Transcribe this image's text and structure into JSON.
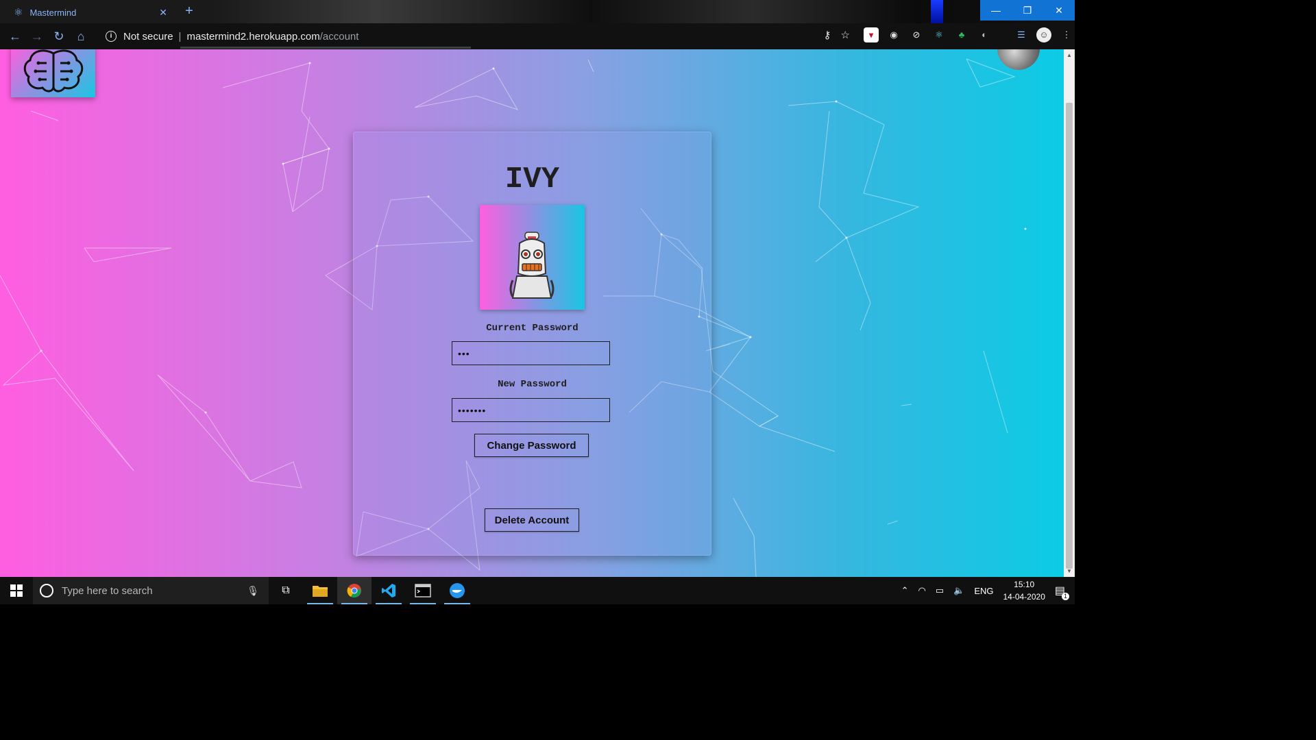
{
  "browser": {
    "tab_title": "Mastermind",
    "tab_icon": "react-icon",
    "security_label": "Not secure",
    "url_host": "mastermind2.herokuapp.com",
    "url_path": "/account",
    "window_controls": [
      "minimize",
      "restore",
      "close"
    ]
  },
  "page": {
    "title": "IVY",
    "current_password_label": "Current Password",
    "current_password_value": "•••",
    "new_password_label": "New Password",
    "new_password_value": "•••••••",
    "change_password_button": "Change Password",
    "delete_account_button": "Delete Account"
  },
  "taskbar": {
    "search_placeholder": "Type here to search",
    "language": "ENG",
    "time": "15:10",
    "date": "14-04-2020",
    "notification_count": "1"
  },
  "colors": {
    "gradient_left": "#ff5ee0",
    "gradient_right": "#0ccbe4",
    "accent": "#1173d4"
  }
}
